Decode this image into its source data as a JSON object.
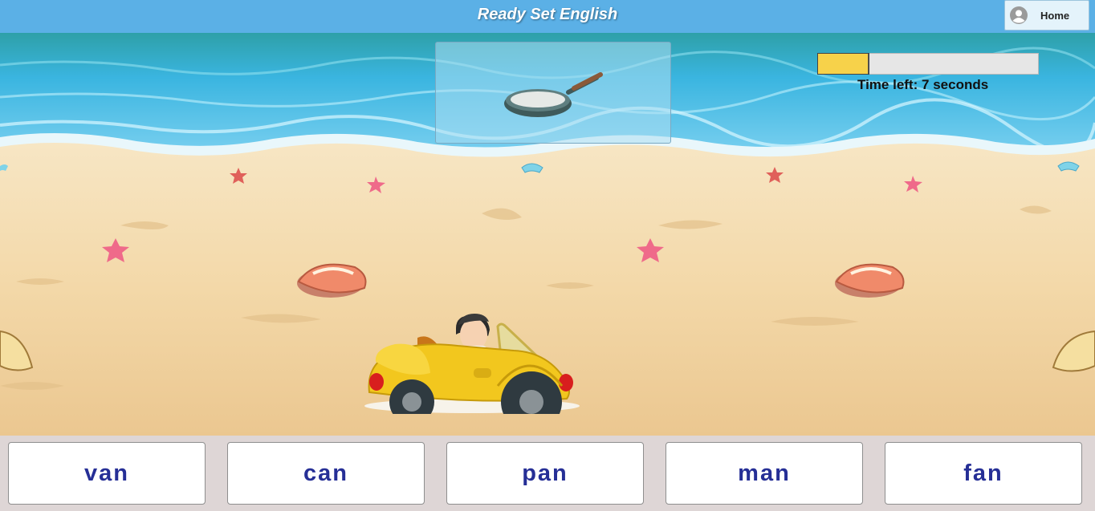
{
  "header": {
    "title": "Ready Set English",
    "home_label": "Home"
  },
  "question": {
    "picture": "frying-pan"
  },
  "timer": {
    "label": "Time left:",
    "seconds": "7",
    "unit": "seconds",
    "remaining_fraction": 0.23
  },
  "choices": [
    {
      "label": "van"
    },
    {
      "label": "can"
    },
    {
      "label": "pan"
    },
    {
      "label": "man"
    },
    {
      "label": "fan"
    }
  ],
  "colors": {
    "header": "#5bb0e6",
    "choice_text": "#262f96",
    "timer_fill": "#f7d24a",
    "sand": "#f3d9ac",
    "sea": "#3aa6d6"
  }
}
